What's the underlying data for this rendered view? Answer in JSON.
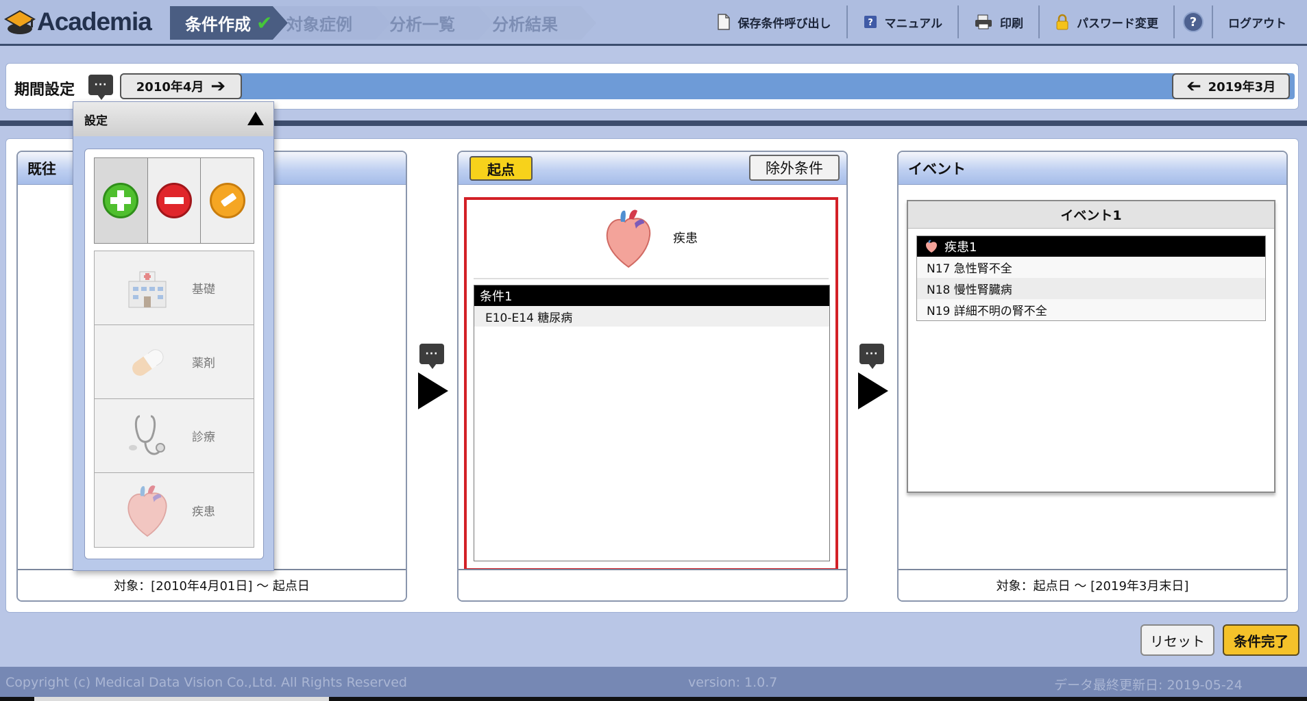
{
  "app": {
    "logo_text": "Academia"
  },
  "steps": [
    {
      "label": "条件作成",
      "active": true
    },
    {
      "label": "対象症例"
    },
    {
      "label": "分析一覧"
    },
    {
      "label": "分析結果"
    }
  ],
  "nav": {
    "load_saved": "保存条件呼び出し",
    "manual": "マニュアル",
    "print": "印刷",
    "password": "パスワード変更",
    "help": "?",
    "logout": "ログアウト"
  },
  "period": {
    "label": "期間設定",
    "comment": "···",
    "start": "2010年4月",
    "end": "2019年3月"
  },
  "columns": {
    "history": {
      "title": "既往",
      "footer": "対象：[2010年4月01日] ～ 起点日"
    },
    "origin": {
      "title": "起点",
      "exclude_label": "除外条件",
      "disease_label": "疾患",
      "condition_title": "条件1",
      "condition_items": [
        "E10-E14 糖尿病"
      ]
    },
    "event": {
      "title": "イベント",
      "card_title": "イベント1",
      "list_title": "疾患1",
      "items": [
        "N17 急性腎不全",
        "N18 慢性腎臓病",
        "N19 詳細不明の腎不全"
      ],
      "footer": "対象：起点日 ～ [2019年3月末日]"
    }
  },
  "dropdown": {
    "title": "設定",
    "categories": [
      "基礎",
      "薬剤",
      "診療",
      "疾患"
    ]
  },
  "buttons": {
    "reset": "リセット",
    "done": "条件完了"
  },
  "footer": {
    "copyright": "Copyright (c) Medical Data Vision Co.,Ltd. All Rights Reserved",
    "version": "version: 1.0.7",
    "updated": "データ最終更新日: 2019-05-24"
  },
  "colors": {
    "accent": "#f7d21b",
    "highlight_border": "#d32027",
    "header_bg": "#aebde0",
    "footer_bg": "#7688b4"
  }
}
